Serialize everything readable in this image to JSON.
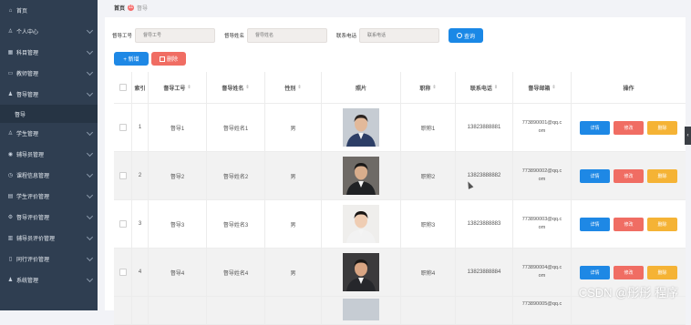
{
  "sidebar": {
    "items": [
      {
        "label": "首页",
        "icon": "home-icon",
        "glyph": "⌂"
      },
      {
        "label": "个人中心",
        "icon": "user-icon",
        "glyph": "♙"
      },
      {
        "label": "科目管理",
        "icon": "grid-icon",
        "glyph": "▦"
      },
      {
        "label": "教师管理",
        "icon": "folder-icon",
        "glyph": "▭"
      },
      {
        "label": "督导管理",
        "icon": "user-group-icon",
        "glyph": "♟"
      },
      {
        "label": "督导",
        "sub": true
      },
      {
        "label": "学生管理",
        "icon": "person-icon",
        "glyph": "♙"
      },
      {
        "label": "辅导员管理",
        "icon": "location-icon",
        "glyph": "◉"
      },
      {
        "label": "课程信息管理",
        "icon": "clock-icon",
        "glyph": "◷"
      },
      {
        "label": "学生评价管理",
        "icon": "clipboard-icon",
        "glyph": "▤"
      },
      {
        "label": "督导评价管理",
        "icon": "gear-icon",
        "glyph": "⚙"
      },
      {
        "label": "辅导员评价管理",
        "icon": "document-icon",
        "glyph": "▥"
      },
      {
        "label": "同行评价管理",
        "icon": "chart-icon",
        "glyph": "▯"
      },
      {
        "label": "系统管理",
        "icon": "people-icon",
        "glyph": "♟"
      }
    ]
  },
  "breadcrumb": {
    "home": "首页",
    "badge": "11",
    "current": "督导"
  },
  "search": {
    "fields": [
      {
        "label": "督导工号",
        "placeholder": "督导工号"
      },
      {
        "label": "督导姓名",
        "placeholder": "督导姓名"
      },
      {
        "label": "联系电话",
        "placeholder": "联系电话"
      }
    ],
    "button": "查询",
    "button_icon": "search-icon"
  },
  "toolbar": {
    "add": "+ 新增",
    "delete": "删除"
  },
  "table": {
    "headers": {
      "index": "索引",
      "id": "督导工号",
      "name": "督导姓名",
      "gender": "性别",
      "photo": "照片",
      "title": "职称",
      "phone": "联系电话",
      "email": "督导邮箱",
      "ops": "操作"
    },
    "sort_glyph": "⇕",
    "actions": {
      "detail": "详情",
      "edit": "修改",
      "remove": "删除"
    },
    "rows": [
      {
        "index": "1",
        "id": "督导1",
        "name": "督导姓名1",
        "gender": "男",
        "title": "职称1",
        "phone": "13823888881",
        "email_a": "773890001@qq.c",
        "email_b": "om",
        "shirt": "#2c3e66",
        "bg": "#c6ccd3",
        "skin": "#e2b99a",
        "hair": "#2a2320"
      },
      {
        "index": "2",
        "id": "督导2",
        "name": "督导姓名2",
        "gender": "男",
        "title": "职称2",
        "phone": "13823888882",
        "email_a": "773890002@qq.c",
        "email_b": "om",
        "shirt": "#1f2124",
        "bg": "#6e6a66",
        "skin": "#d8ad8c",
        "hair": "#1a1817"
      },
      {
        "index": "3",
        "id": "督导3",
        "name": "督导姓名3",
        "gender": "男",
        "title": "职称3",
        "phone": "13823888883",
        "email_a": "773890003@qq.c",
        "email_b": "om",
        "shirt": "#f2f2f2",
        "bg": "#efeeec",
        "skin": "#efcdb3",
        "hair": "#171413"
      },
      {
        "index": "4",
        "id": "督导4",
        "name": "督导姓名4",
        "gender": "男",
        "title": "职称4",
        "phone": "13823888884",
        "email_a": "773890004@qq.c",
        "email_b": "om",
        "shirt": "#26272b",
        "bg": "#3b3a3c",
        "skin": "#d9a583",
        "hair": "#1b1816"
      }
    ],
    "partial_email": "773890005@qq.c"
  },
  "watermark": "CSDN @彤彤 程序"
}
